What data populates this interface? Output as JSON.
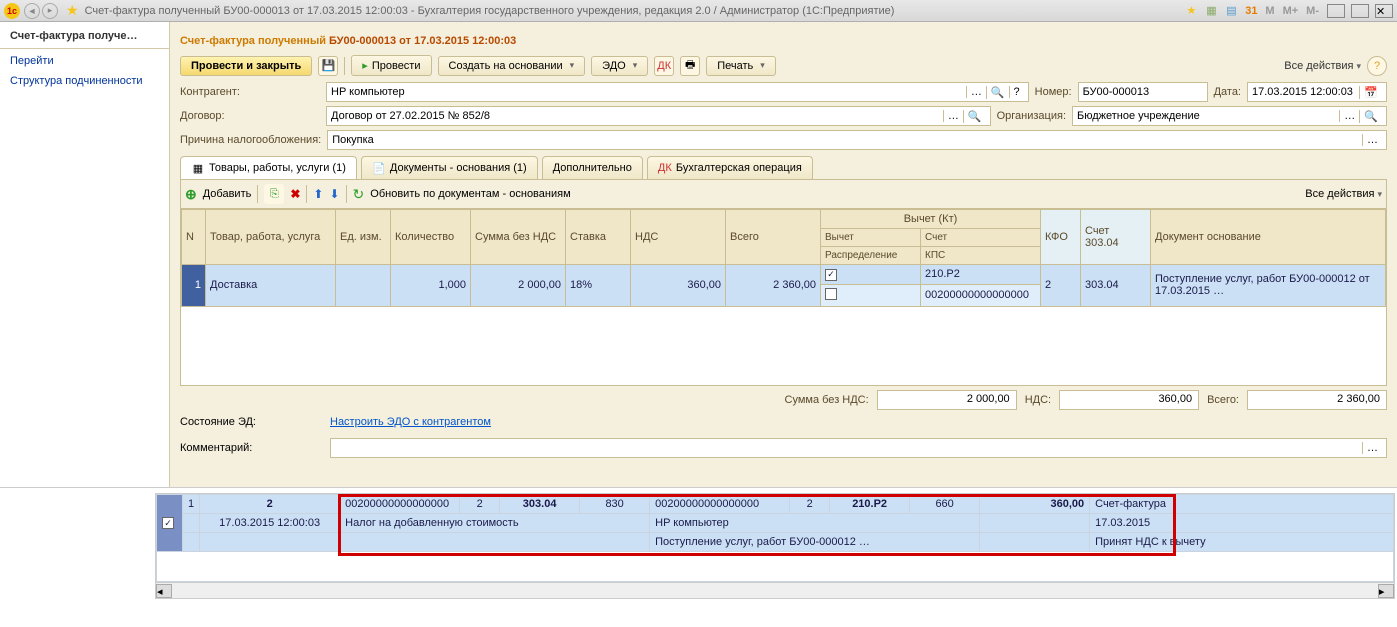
{
  "titlebar": {
    "text": "Счет-фактура полученный БУ00-000013 от 17.03.2015 12:00:03 - Бухгалтерия государственного учреждения, редакция 2.0 / Администратор  (1С:Предприятие)",
    "m_buttons": [
      "M",
      "M+",
      "M-"
    ]
  },
  "sidebar": {
    "items": [
      {
        "label": "Счет-фактура получе…",
        "active": true
      },
      {
        "label": "Перейти",
        "active": false
      },
      {
        "label": "Структура подчиненности",
        "active": false
      }
    ]
  },
  "page": {
    "title_prefix": "Счет-фактура полученный ",
    "title_docnum": "БУ00-000013 от 17.03.2015 12:00:03"
  },
  "toolbar": {
    "post_close": "Провести и закрыть",
    "post": "Провести",
    "create_based": "Создать на основании",
    "edo": "ЭДО",
    "print": "Печать",
    "all_actions": "Все действия"
  },
  "form": {
    "counterparty_label": "Контрагент:",
    "counterparty_value": "HP компьютер",
    "number_label": "Номер:",
    "number_value": "БУ00-000013",
    "date_label": "Дата:",
    "date_value": "17.03.2015 12:00:03",
    "contract_label": "Договор:",
    "contract_value": "Договор от 27.02.2015 № 852/8",
    "org_label": "Организация:",
    "org_value": "Бюджетное учреждение",
    "tax_reason_label": "Причина налогообложения:",
    "tax_reason_value": "Покупка"
  },
  "tabs": [
    {
      "label": "Товары, работы, услуги (1)",
      "active": true
    },
    {
      "label": "Документы - основания (1)",
      "active": false
    },
    {
      "label": "Дополнительно",
      "active": false
    },
    {
      "label": "Бухгалтерская операция",
      "active": false
    }
  ],
  "tab_toolbar": {
    "add": "Добавить",
    "refresh": "Обновить по документам - основаниям",
    "all_actions": "Все действия"
  },
  "grid": {
    "headers": {
      "n": "N",
      "item": "Товар, работа, услуга",
      "unit": "Ед. изм.",
      "qty": "Количество",
      "sum_no_vat": "Сумма без НДС",
      "rate": "Ставка",
      "vat": "НДС",
      "total": "Всего",
      "deduct_kt": "Вычет (Кт)",
      "deduct": "Вычет",
      "account": "Счет",
      "distribution": "Распределение",
      "kps": "КПС",
      "kfo": "КФО",
      "acc303": "Счет 303.04",
      "docbase": "Документ основание"
    },
    "row": {
      "n": "1",
      "item": "Доставка",
      "unit": "",
      "qty": "1,000",
      "sum_no_vat": "2 000,00",
      "rate": "18%",
      "vat": "360,00",
      "total": "2 360,00",
      "checked": true,
      "account": "210.P2",
      "kps": "00200000000000000",
      "kfo": "2",
      "acc303": "303.04",
      "docbase": "Поступление услуг, работ БУ00-000012 от 17.03.2015 …"
    }
  },
  "totals": {
    "sum_no_vat_label": "Сумма без НДС:",
    "sum_no_vat": "2 000,00",
    "vat_label": "НДС:",
    "vat": "360,00",
    "total_label": "Всего:",
    "total": "2 360,00"
  },
  "state": {
    "ed_label": "Состояние ЭД:",
    "ed_link": "Настроить ЭДО с контрагентом",
    "comment_label": "Комментарий:",
    "comment_value": ""
  },
  "bottom": {
    "row1": {
      "c1": "1",
      "c2": "2",
      "c3": "00200000000000000",
      "c4": "2",
      "c5": "303.04",
      "c6": "830",
      "c7": "00200000000000000",
      "c8": "2",
      "c9": "210.P2",
      "c10": "660",
      "c11": "360,00",
      "c12": "Счет-фактура"
    },
    "row2": {
      "c1": "17.03.2015 12:00:03",
      "c2": "Налог на добавленную стоимость",
      "c3": "HP компьютер",
      "c4": "17.03.2015"
    },
    "row3": {
      "c1": "Поступление услуг, работ БУ00-000012 …",
      "c2": "Принят НДС к вычету"
    }
  }
}
